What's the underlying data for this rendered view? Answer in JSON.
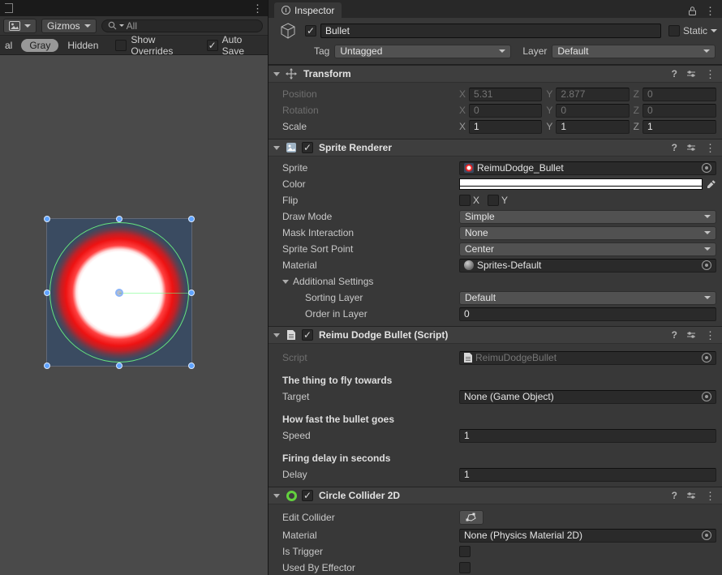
{
  "icons": {
    "kebab": "⋮",
    "help": "?",
    "check": "✓"
  },
  "left_pane": {
    "toolbar": {
      "gizmos_label": "Gizmos",
      "search_value": "All"
    },
    "prefab_bar": {
      "normal_cutoff": "al",
      "gray": "Gray",
      "hidden": "Hidden",
      "show_overrides": "Show Overrides",
      "auto_save": "Auto Save"
    }
  },
  "inspector": {
    "tab": "Inspector",
    "game_object": {
      "name": "Bullet",
      "static_label": "Static",
      "tag_label": "Tag",
      "tag": "Untagged",
      "layer_label": "Layer",
      "layer": "Default"
    },
    "transform": {
      "title": "Transform",
      "axis": {
        "x": "X",
        "y": "Y",
        "z": "Z"
      },
      "position": {
        "label": "Position",
        "x": "5.31",
        "y": "2.877",
        "z": "0"
      },
      "rotation": {
        "label": "Rotation",
        "x": "0",
        "y": "0",
        "z": "0"
      },
      "scale": {
        "label": "Scale",
        "x": "1",
        "y": "1",
        "z": "1"
      }
    },
    "sprite_renderer": {
      "title": "Sprite Renderer",
      "sprite_label": "Sprite",
      "sprite_value": "ReimuDodge_Bullet",
      "color_label": "Color",
      "flip_label": "Flip",
      "flip_x": "X",
      "flip_y": "Y",
      "draw_mode_label": "Draw Mode",
      "draw_mode": "Simple",
      "mask_interaction_label": "Mask Interaction",
      "mask_interaction": "None",
      "sort_point_label": "Sprite Sort Point",
      "sort_point": "Center",
      "material_label": "Material",
      "material_value": "Sprites-Default",
      "additional_settings_label": "Additional Settings",
      "sorting_layer_label": "Sorting Layer",
      "sorting_layer": "Default",
      "order_in_layer_label": "Order in Layer",
      "order_in_layer": "0"
    },
    "script_component": {
      "title": "Reimu Dodge Bullet (Script)",
      "script_label": "Script",
      "script_value": "ReimuDodgeBullet",
      "target_header": "The thing to fly towards",
      "target_label": "Target",
      "target_value": "None (Game Object)",
      "speed_header": "How fast the bullet goes",
      "speed_label": "Speed",
      "speed_value": "1",
      "delay_header": "Firing delay in seconds",
      "delay_label": "Delay",
      "delay_value": "1"
    },
    "circle_collider": {
      "title": "Circle Collider 2D",
      "edit_collider_label": "Edit Collider",
      "material_label": "Material",
      "material_value": "None (Physics Material 2D)",
      "is_trigger_label": "Is Trigger",
      "used_by_effector_label": "Used By Effector"
    }
  }
}
